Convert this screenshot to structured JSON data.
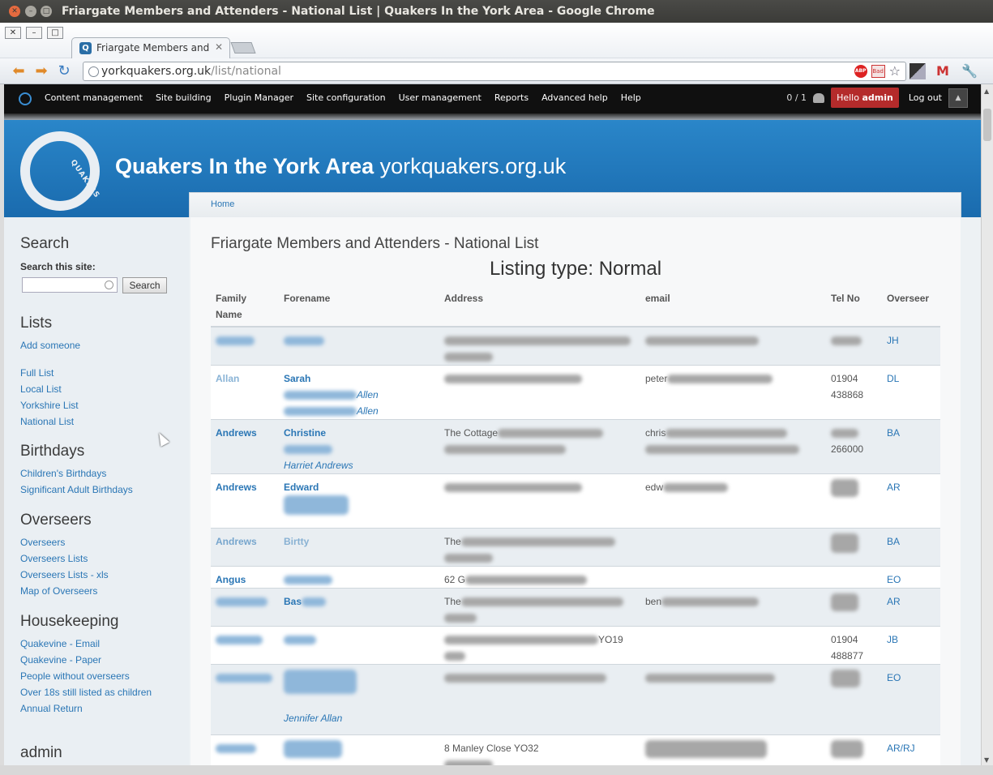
{
  "window": {
    "title": "Friargate Members and Attenders - National List | Quakers In the York Area - Google Chrome"
  },
  "browser": {
    "tab_label": "Friargate Members and At",
    "url_host": "yorkquakers.org.uk",
    "url_path": "/list/national",
    "ext_abp": "ABP",
    "ext_bad": "Bad"
  },
  "admin_bar": {
    "items": [
      "Content management",
      "Site building",
      "Plugin Manager",
      "Site configuration",
      "User management",
      "Reports",
      "Advanced help",
      "Help"
    ],
    "user_count": "0 / 1",
    "hello_prefix": "Hello",
    "hello_user": "admin",
    "logout": "Log out"
  },
  "header": {
    "site_name": "Quakers In the York Area",
    "slogan": "yorkquakers.org.uk",
    "logo_text": "QUAKERS"
  },
  "breadcrumb": {
    "home": "Home"
  },
  "sidebar": {
    "search": {
      "heading": "Search",
      "label": "Search this site:",
      "button": "Search"
    },
    "lists": {
      "heading": "Lists",
      "add": "Add someone",
      "items": [
        "Full List",
        "Local List",
        "Yorkshire List",
        "National List"
      ]
    },
    "birthdays": {
      "heading": "Birthdays",
      "items": [
        "Children's Birthdays",
        "Significant Adult Birthdays"
      ]
    },
    "overseers": {
      "heading": "Overseers",
      "items": [
        "Overseers",
        "Overseers Lists",
        "Overseers Lists - xls",
        "Map of Overseers"
      ]
    },
    "housekeeping": {
      "heading": "Housekeeping",
      "items": [
        "Quakevine - Email",
        "Quakevine - Paper",
        "People without overseers",
        "Over 18s still listed as children",
        "Annual Return"
      ]
    },
    "admin_heading": "admin"
  },
  "main": {
    "title": "Friargate Members and Attenders - National List",
    "listing_type": "Listing type: Normal",
    "columns": [
      "Family Name",
      "Forename",
      "Address",
      "email",
      "Tel No",
      "Overseer"
    ],
    "rows": [
      {
        "family": "",
        "forename": "",
        "extra": [],
        "address": "",
        "email": "",
        "tel": "",
        "overseer": "JH"
      },
      {
        "family": "Allan",
        "forename": "Sarah",
        "extra": [
          "Allen",
          "Allen"
        ],
        "address": "",
        "email": "peter",
        "tel": "01904 438868",
        "overseer": "DL"
      },
      {
        "family": "Andrews",
        "forename": "Christine",
        "extra": [
          "Harriet Andrews"
        ],
        "address": "The Cottage",
        "email": "chris",
        "tel": "266000",
        "overseer": "BA"
      },
      {
        "family": "Andrews",
        "forename": "Edward",
        "extra": [],
        "address": "",
        "email": "edw",
        "tel": "",
        "overseer": "AR"
      },
      {
        "family": "Andrews",
        "forename": "Birtty",
        "extra": [],
        "address": "The",
        "email": "",
        "tel": "",
        "overseer": "BA"
      },
      {
        "family": "Angus",
        "forename": "",
        "extra": [],
        "address": "62 G",
        "email": "",
        "tel": "",
        "overseer": "EO"
      },
      {
        "family": "",
        "forename": "Bas",
        "extra": [],
        "address": "The",
        "email": "ben",
        "tel": "",
        "overseer": "AR"
      },
      {
        "family": "",
        "forename": "",
        "extra": [],
        "address": "YO19",
        "email": "",
        "tel": "01904 488877",
        "overseer": "JB"
      },
      {
        "family": "",
        "forename": "",
        "extra": [
          "Jennifer Allan"
        ],
        "address": "",
        "email": "",
        "tel": "",
        "overseer": "EO"
      },
      {
        "family": "",
        "forename": "",
        "extra": [],
        "address": "8 Manley Close YO32",
        "email": "",
        "tel": "",
        "overseer": "AR/RJ"
      }
    ]
  }
}
